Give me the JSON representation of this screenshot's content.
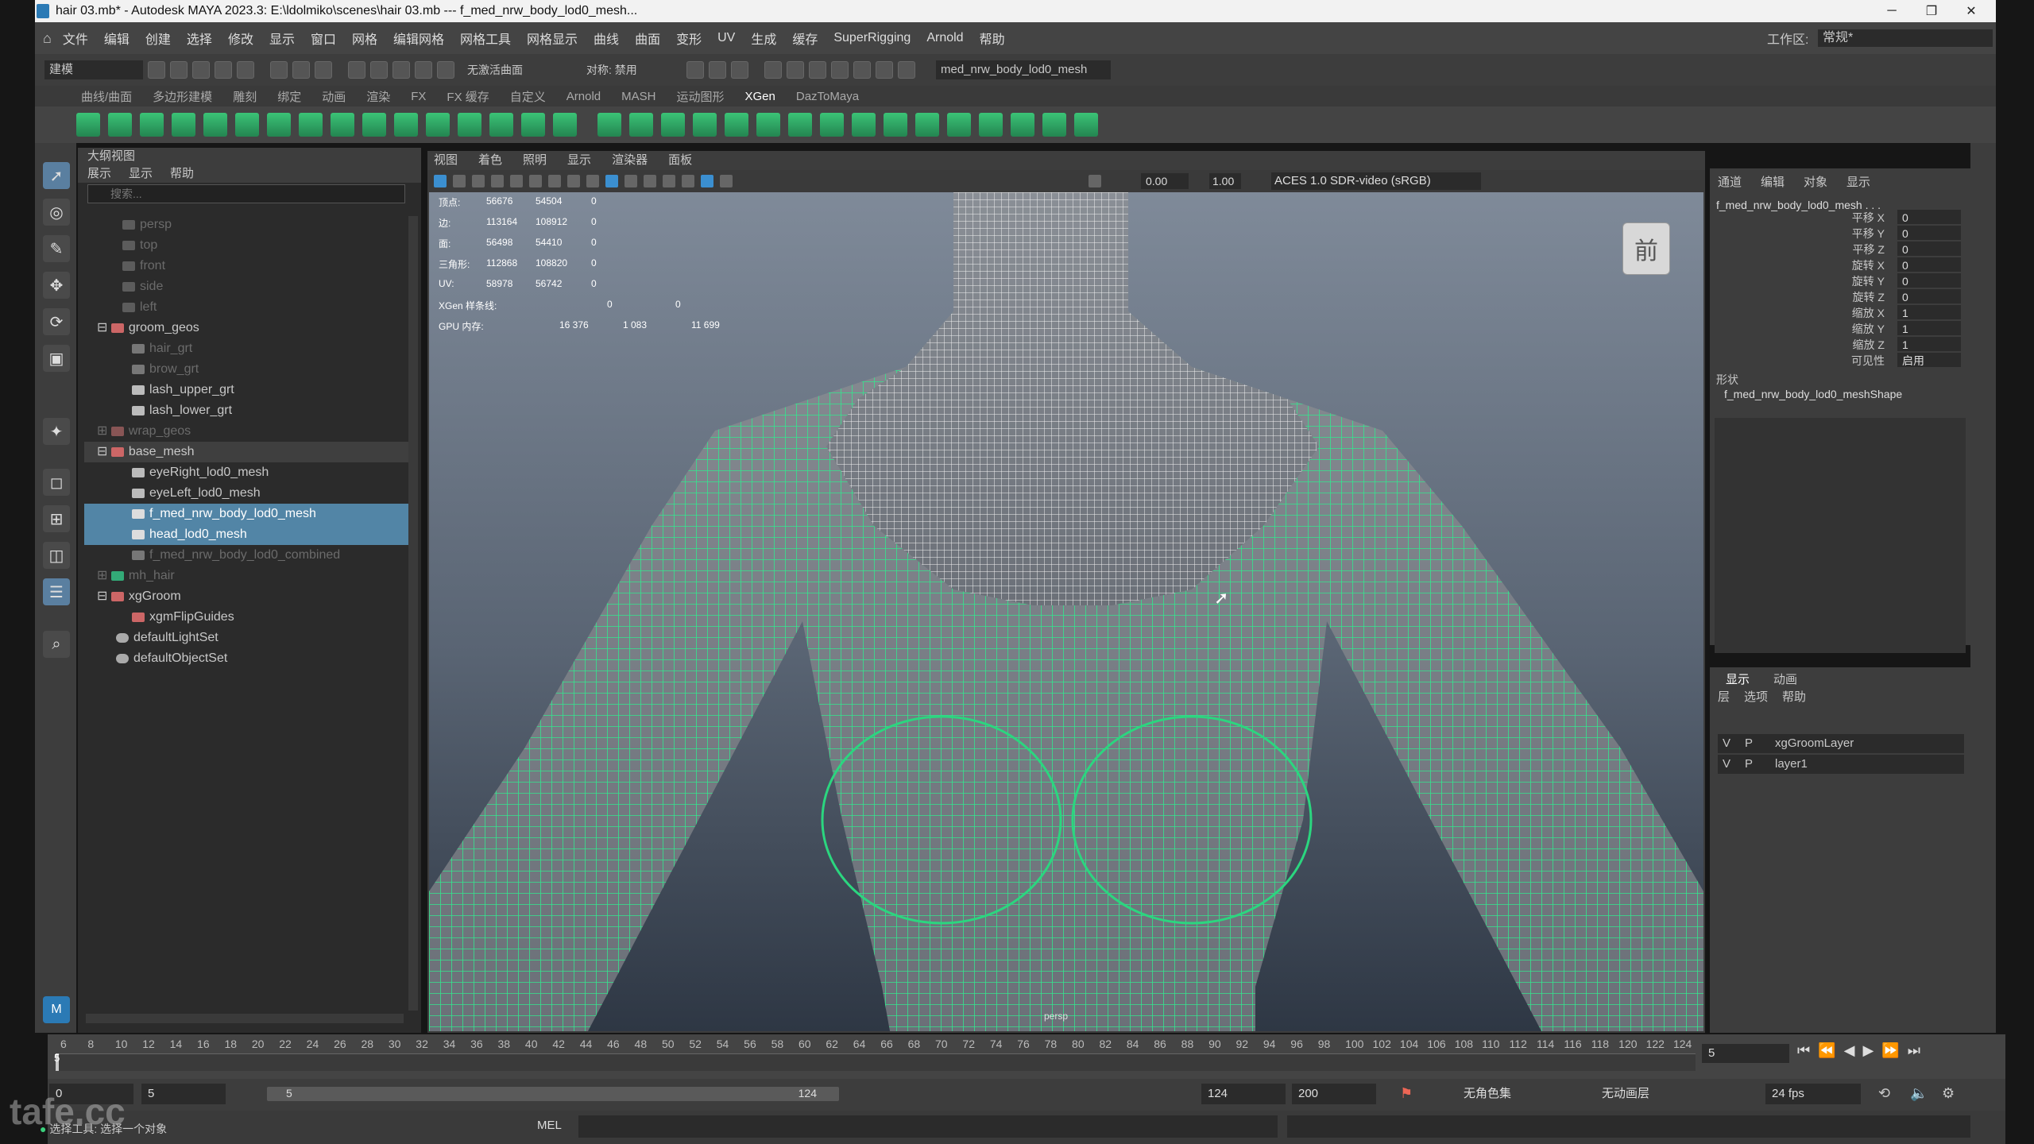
{
  "window": {
    "title": "hair 03.mb* - Autodesk MAYA 2023.3: E:\\ldolmiko\\scenes\\hair 03.mb  ---  f_med_nrw_body_lod0_mesh...",
    "minimize": "─",
    "restore": "❐",
    "close": "✕"
  },
  "menubar": {
    "items": [
      "文件",
      "编辑",
      "创建",
      "选择",
      "修改",
      "显示",
      "窗口",
      "网格",
      "编辑网格",
      "网格工具",
      "网格显示",
      "曲线",
      "曲面",
      "变形",
      "UV",
      "生成",
      "缓存",
      "SuperRigging",
      "Arnold",
      "帮助"
    ],
    "workspace_label": "工作区:",
    "workspace_value": "常规*"
  },
  "statusline": {
    "mode": "建模",
    "live_surface": "无激活曲面",
    "symmetry": "对称: 禁用",
    "object_field": "med_nrw_body_lod0_mesh"
  },
  "shelf": {
    "tabs": [
      "曲线/曲面",
      "多边形建模",
      "雕刻",
      "绑定",
      "动画",
      "渲染",
      "FX",
      "FX 缓存",
      "自定义",
      "Arnold",
      "MASH",
      "运动图形",
      "XGen",
      "DazToMaya"
    ],
    "active_tab": "XGen"
  },
  "outliner": {
    "title": "大纲视图",
    "menu": [
      "展示",
      "显示",
      "帮助"
    ],
    "search_placeholder": "搜索...",
    "rows": [
      {
        "label": "persp"
      },
      {
        "label": "top"
      },
      {
        "label": "front"
      },
      {
        "label": "side"
      },
      {
        "label": "left"
      },
      {
        "label": "groom_geos"
      },
      {
        "label": "hair_grt"
      },
      {
        "label": "brow_grt"
      },
      {
        "label": "lash_upper_grt"
      },
      {
        "label": "lash_lower_grt"
      },
      {
        "label": "wrap_geos"
      },
      {
        "label": "base_mesh"
      },
      {
        "label": "eyeRight_lod0_mesh"
      },
      {
        "label": "eyeLeft_lod0_mesh"
      },
      {
        "label": "f_med_nrw_body_lod0_mesh"
      },
      {
        "label": "head_lod0_mesh"
      },
      {
        "label": "f_med_nrw_body_lod0_combined"
      },
      {
        "label": "mh_hair"
      },
      {
        "label": "xgGroom"
      },
      {
        "label": "xgmFlipGuides"
      },
      {
        "label": "defaultLightSet"
      },
      {
        "label": "defaultObjectSet"
      }
    ]
  },
  "viewport": {
    "menu": [
      "视图",
      "着色",
      "照明",
      "显示",
      "渲染器",
      "面板"
    ],
    "exposure": "0.00",
    "gamma": "1.00",
    "color_space": "ACES 1.0 SDR-video (sRGB)",
    "camera_label": "persp",
    "viewcube_label": "前",
    "hud": {
      "rows": [
        {
          "label": "顶点:",
          "a": "56676",
          "b": "54504",
          "c": "0"
        },
        {
          "label": "边:",
          "a": "113164",
          "b": "108912",
          "c": "0"
        },
        {
          "label": "面:",
          "a": "56498",
          "b": "54410",
          "c": "0"
        },
        {
          "label": "三角形:",
          "a": "112868",
          "b": "108820",
          "c": "0"
        },
        {
          "label": "UV:",
          "a": "58978",
          "b": "56742",
          "c": "0"
        }
      ],
      "xgen_label": "XGen 样条线:",
      "xgen_a": "0",
      "xgen_b": "0",
      "gpu_label": "GPU 内存:",
      "gpu_a": "16 376",
      "gpu_b": "1 083",
      "gpu_c": "11 699"
    }
  },
  "channelbox": {
    "menu": [
      "通道",
      "编辑",
      "对象",
      "显示"
    ],
    "object": "f_med_nrw_body_lod0_mesh . . .",
    "channels": [
      {
        "label": "平移 X",
        "value": "0"
      },
      {
        "label": "平移 Y",
        "value": "0"
      },
      {
        "label": "平移 Z",
        "value": "0"
      },
      {
        "label": "旋转 X",
        "value": "0"
      },
      {
        "label": "旋转 Y",
        "value": "0"
      },
      {
        "label": "旋转 Z",
        "value": "0"
      },
      {
        "label": "缩放 X",
        "value": "1"
      },
      {
        "label": "缩放 Y",
        "value": "1"
      },
      {
        "label": "缩放 Z",
        "value": "1"
      },
      {
        "label": "可见性",
        "value": "启用"
      }
    ],
    "shapes_label": "形状",
    "shape_name": "f_med_nrw_body_lod0_meshShape"
  },
  "layereditor": {
    "tabs": [
      "显示",
      "动画"
    ],
    "menu": [
      "层",
      "选项",
      "帮助"
    ],
    "layers": [
      {
        "v": "V",
        "p": "P",
        "name": "xgGroomLayer"
      },
      {
        "v": "V",
        "p": "P",
        "name": "layer1"
      }
    ]
  },
  "timeline": {
    "ticks": [
      "6",
      "8",
      "10",
      "12",
      "14",
      "16",
      "18",
      "20",
      "22",
      "24",
      "26",
      "28",
      "30",
      "32",
      "34",
      "36",
      "38",
      "40",
      "42",
      "44",
      "46",
      "48",
      "50",
      "52",
      "54",
      "56",
      "58",
      "60",
      "62",
      "64",
      "66",
      "68",
      "70",
      "72",
      "74",
      "76",
      "78",
      "80",
      "82",
      "84",
      "86",
      "88",
      "90",
      "92",
      "94",
      "96",
      "98",
      "100",
      "102",
      "104",
      "106",
      "108",
      "110",
      "112",
      "114",
      "116",
      "118",
      "120",
      "122",
      "124"
    ],
    "current_frame": "5",
    "start_tick": "5",
    "range_start": "0",
    "range_inner_start": "5",
    "slider_start": "5",
    "slider_end": "124",
    "range_inner_end": "124",
    "range_end": "200",
    "character_set": "无角色集",
    "anim_layer": "无动画层",
    "fps": "24 fps"
  },
  "commandline": {
    "lang": "MEL",
    "help": "选择工具: 选择一个对象"
  },
  "watermark": "tafe.cc"
}
